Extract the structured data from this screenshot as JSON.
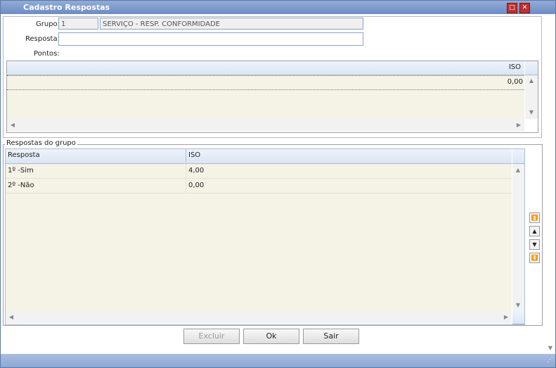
{
  "window": {
    "title": "Cadastro Respostas",
    "maximize_icon": "maximize-icon",
    "close_icon": "close-icon"
  },
  "form": {
    "grupo_label": "Grupo:",
    "grupo_code": "1",
    "grupo_name": "SERVIÇO - RESP. CONFORMIDADE",
    "resposta_label": "Resposta:",
    "resposta_value": "",
    "pontos_label": "Pontos:"
  },
  "points_grid": {
    "columns": [
      "ISO"
    ],
    "rows": [
      [
        "0,00"
      ]
    ]
  },
  "answers_group": {
    "legend": "Respostas do grupo",
    "columns": [
      "Resposta",
      "ISO"
    ],
    "rows": [
      [
        "1º -Sim",
        "4,00"
      ],
      [
        "2º -Não",
        "0,00"
      ]
    ]
  },
  "nav_icons": [
    "move-top-icon",
    "move-up-icon",
    "move-down-icon",
    "move-bottom-icon"
  ],
  "buttons": {
    "excluir": "Excluir",
    "ok": "Ok",
    "sair": "Sair"
  },
  "colors": {
    "title_bar": "#6d8cc4",
    "close_button": "#c0302c",
    "grid_body": "#f5f2e6"
  }
}
